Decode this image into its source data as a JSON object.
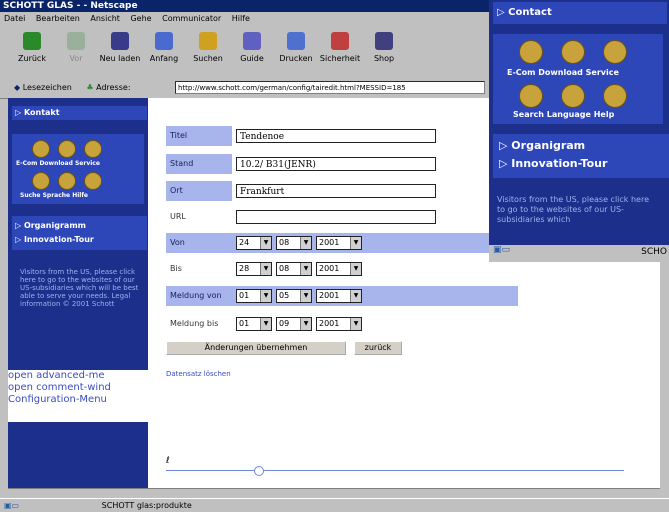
{
  "window": {
    "title": "SCHOTT GLAS - - Netscape"
  },
  "menu": [
    "Datei",
    "Bearbeiten",
    "Ansicht",
    "Gehe",
    "Communicator",
    "Hilfe"
  ],
  "toolbar": [
    {
      "label": "Zurück",
      "icon": "back-arrow-icon"
    },
    {
      "label": "Vor",
      "icon": "forward-arrow-icon"
    },
    {
      "label": "Neu laden",
      "icon": "reload-icon"
    },
    {
      "label": "Anfang",
      "icon": "home-icon"
    },
    {
      "label": "Suchen",
      "icon": "search-icon"
    },
    {
      "label": "Guide",
      "icon": "guide-icon"
    },
    {
      "label": "Drucken",
      "icon": "print-icon"
    },
    {
      "label": "Sicherheit",
      "icon": "lock-icon"
    },
    {
      "label": "Shop",
      "icon": "shop-icon"
    }
  ],
  "location": {
    "bookmarks_label": "Lesezeichen",
    "address_label": "Adresse:",
    "url": "http://www.schott.com/german/config/tairedit.html?MESSID=185"
  },
  "leftnav": {
    "kontakt": "▷ Kontakt",
    "icon_labels_top": "E-Com  Download  Service",
    "icon_labels_bottom": "Suche  Sprache  Hilfe",
    "organigramm": "▷ Organigramm",
    "innovation": "▷ Innovation-Tour",
    "visitor_text": "Visitors from the US, please click here to go to the websites of our US-subsidiaries which will be best able to serve your needs. Legal information © 2001 Schott"
  },
  "config": {
    "line1": "open advanced-me",
    "line2": "open comment-wind",
    "line3": "Configuration-Menu"
  },
  "form": {
    "titel_label": "Titel",
    "titel_value": "Tendenoe",
    "stand_label": "Stand",
    "stand_value": "10.2/ B31(JENR)",
    "ort_label": "Ort",
    "ort_value": "Frankfurt",
    "url_label": "URL",
    "url_value": "",
    "von_label": "Von",
    "von": [
      "24",
      "08",
      "2001"
    ],
    "bis_label": "Bis",
    "bis": [
      "28",
      "08",
      "2001"
    ],
    "meldung_von_label": "Meldung von",
    "meldung_von": [
      "01",
      "05",
      "2001"
    ],
    "meldung_bis_label": "Meldung bis",
    "meldung_bis": [
      "01",
      "09",
      "2001"
    ],
    "apply_button": "Änderungen übernehmen",
    "back_button": "zurück",
    "delete_link": "Datensatz löschen"
  },
  "popup": {
    "contact": "▷ Contact",
    "icon_labels_top": "E-Com Download Service",
    "icon_labels_bottom": "Search Language Help",
    "organigram": "▷ Organigram",
    "innovation": "▷ Innovation-Tour",
    "visitor_text": "Visitors from the US, please click here to go to the websites of our US-subsidiaries which",
    "status_tail": "SCHO"
  },
  "status": {
    "text": "SCHOTT glas:produkte"
  },
  "colors": {
    "nav_blue": "#1c2f8a",
    "nav_button": "#2e47b8",
    "label_blue": "#a8b4ec",
    "highlight_row": "#a8b4ec"
  }
}
